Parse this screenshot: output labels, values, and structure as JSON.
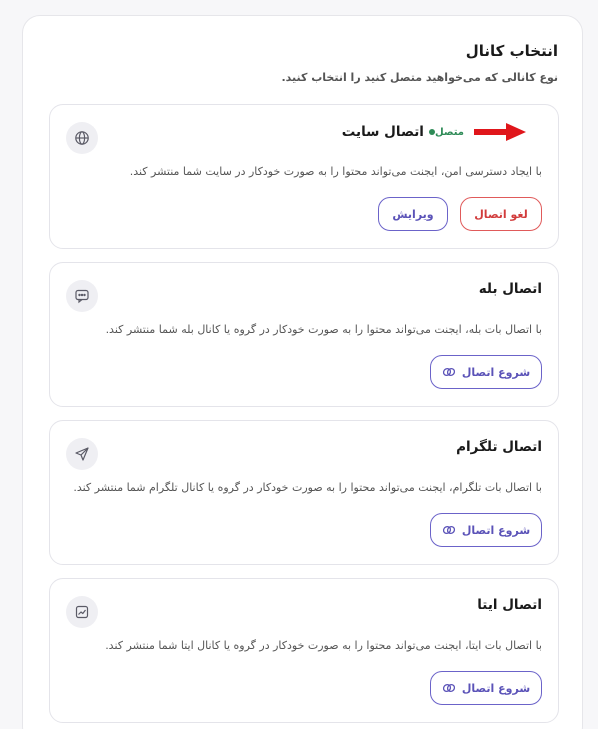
{
  "header": {
    "title": "انتخاب کانال",
    "subtitle": "نوع کانالی که می‌خواهید متصل کنید را انتخاب کنید."
  },
  "cards": [
    {
      "title": "اتصال سایت",
      "status": "متصل",
      "description": "با ایجاد دسترسی امن، ایجنت می‌تواند محتوا را به صورت خودکار در سایت شما منتشر کند.",
      "icon": "globe-icon",
      "buttons": {
        "disconnect": "لغو اتصال",
        "edit": "ویرایش"
      }
    },
    {
      "title": "اتصال بله",
      "description": "با اتصال بات بله، ایجنت می‌تواند محتوا را به صورت خودکار در گروه یا کانال بله شما منتشر کند.",
      "icon": "chat-icon",
      "buttons": {
        "connect": "شروع اتصال"
      }
    },
    {
      "title": "اتصال تلگرام",
      "description": "با اتصال بات تلگرام، ایجنت می‌تواند محتوا را به صورت خودکار در گروه یا کانال تلگرام شما منتشر کند.",
      "icon": "send-icon",
      "buttons": {
        "connect": "شروع اتصال"
      }
    },
    {
      "title": "اتصال ایتا",
      "description": "با اتصال بات ایتا، ایجنت می‌تواند محتوا را به صورت خودکار در گروه یا کانال ایتا شما منتشر کند.",
      "icon": "chart-icon",
      "buttons": {
        "connect": "شروع اتصال"
      }
    }
  ],
  "colors": {
    "status_connected": "#2e8b57",
    "danger": "#d23c3c",
    "primary": "#5b53b8",
    "arrow": "#e0161b"
  }
}
